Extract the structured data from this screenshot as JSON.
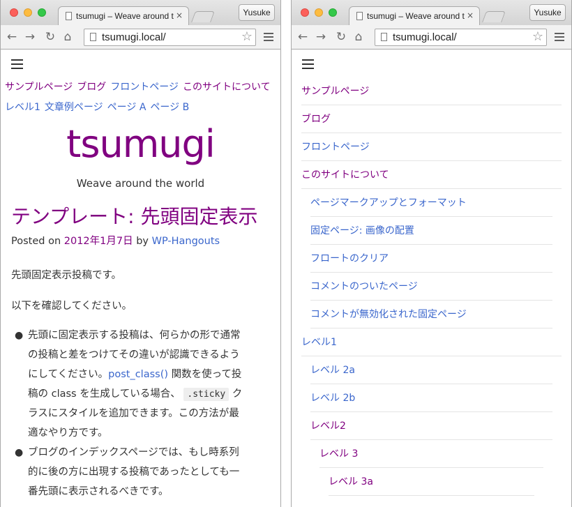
{
  "browser": {
    "tab_title": "tsumugi – Weave around the world",
    "tab_close": "×",
    "user_button": "Yusuke",
    "url": "tsumugi.local/"
  },
  "left": {
    "menu_row1": [
      "サンプルページ",
      "ブログ",
      "フロントページ",
      "このサイトについて"
    ],
    "menu_row2": [
      "レベル1",
      "文章例ページ",
      "ページ A",
      "ページ B"
    ],
    "site_title": "tsumugi",
    "site_description": "Weave around the world",
    "post_title": "テンプレート: 先頭固定表示",
    "meta": {
      "posted_on": "Posted on",
      "date": "2012年1月7日",
      "by": "by",
      "author": "WP-Hangouts"
    },
    "para1": "先頭固定表示投稿です。",
    "para2": "以下を確認してください。",
    "bullet1": {
      "line1": "先頭に固定表示する投稿は、何らかの形で通常",
      "line2": "の投稿と差をつけてその違いが認識できるよう",
      "line3_pre": "にしてください。",
      "line3_link": "post_class()",
      "line3_post": " 関数を使って投",
      "line4_pre": "稿の class を生成している場合、",
      "line4_code": ".sticky",
      "line4_post": " ク",
      "line5": "ラスにスタイルを追加できます。この方法が最",
      "line6": "適なやり方です。"
    },
    "bullet2": {
      "line1": "ブログのインデックスページでは、もし時系列",
      "line2": "的に後の方に出現する投稿であったとしても一",
      "line3": "番先頭に表示されるべきです。"
    }
  },
  "right": {
    "nav_items": [
      {
        "label": "サンプルページ",
        "level": 0,
        "visited": true
      },
      {
        "label": "ブログ",
        "level": 0,
        "visited": true
      },
      {
        "label": "フロントページ",
        "level": 0,
        "visited": false
      },
      {
        "label": "このサイトについて",
        "level": 0,
        "visited": true
      },
      {
        "label": "ページマークアップとフォーマット",
        "level": 1,
        "visited": false
      },
      {
        "label": "固定ページ: 画像の配置",
        "level": 1,
        "visited": false
      },
      {
        "label": "フロートのクリア",
        "level": 1,
        "visited": false
      },
      {
        "label": "コメントのついたページ",
        "level": 1,
        "visited": false
      },
      {
        "label": "コメントが無効化された固定ページ",
        "level": 1,
        "visited": false
      },
      {
        "label": "レベル1",
        "level": 0,
        "visited": false
      },
      {
        "label": "レベル 2a",
        "level": 1,
        "visited": false
      },
      {
        "label": "レベル 2b",
        "level": 1,
        "visited": false
      },
      {
        "label": "レベル2",
        "level": 1,
        "visited": true
      },
      {
        "label": "レベル 3",
        "level": 2,
        "visited": true
      },
      {
        "label": "レベル 3a",
        "level": 3,
        "visited": true
      }
    ]
  },
  "colors": {
    "visited_link": "#800080",
    "link": "#3a66cc"
  }
}
